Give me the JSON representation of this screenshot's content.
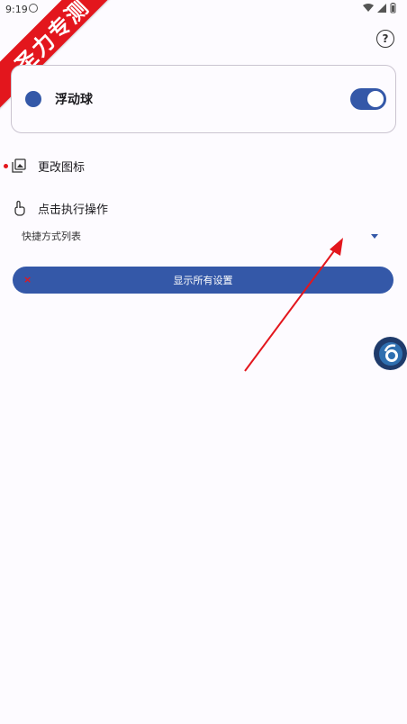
{
  "status_bar": {
    "time": "9:19",
    "icons": [
      "wifi-icon",
      "signal-icon",
      "battery-icon"
    ]
  },
  "watermark": "圣力专测",
  "card": {
    "title": "浮动球",
    "toggle_on": true
  },
  "rows": {
    "change_icon": "更改图标",
    "tap_action": "点击执行操作"
  },
  "dropdown": {
    "selected": "快捷方式列表"
  },
  "primary_button": {
    "label": "显示所有设置"
  },
  "colors": {
    "accent": "#3458a8",
    "background": "#fdfbff",
    "annotation_red": "#e3161d"
  }
}
